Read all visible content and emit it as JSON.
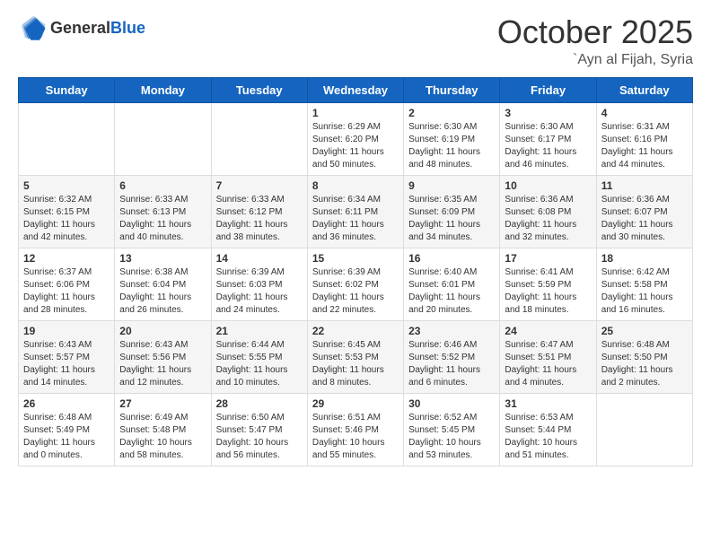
{
  "header": {
    "logo": {
      "general": "General",
      "blue": "Blue"
    },
    "title": "October 2025",
    "location": "`Ayn al Fijah, Syria"
  },
  "weekdays": [
    "Sunday",
    "Monday",
    "Tuesday",
    "Wednesday",
    "Thursday",
    "Friday",
    "Saturday"
  ],
  "weeks": [
    [
      {
        "day": null
      },
      {
        "day": null
      },
      {
        "day": null
      },
      {
        "day": 1,
        "sunrise": "Sunrise: 6:29 AM",
        "sunset": "Sunset: 6:20 PM",
        "daylight": "Daylight: 11 hours and 50 minutes."
      },
      {
        "day": 2,
        "sunrise": "Sunrise: 6:30 AM",
        "sunset": "Sunset: 6:19 PM",
        "daylight": "Daylight: 11 hours and 48 minutes."
      },
      {
        "day": 3,
        "sunrise": "Sunrise: 6:30 AM",
        "sunset": "Sunset: 6:17 PM",
        "daylight": "Daylight: 11 hours and 46 minutes."
      },
      {
        "day": 4,
        "sunrise": "Sunrise: 6:31 AM",
        "sunset": "Sunset: 6:16 PM",
        "daylight": "Daylight: 11 hours and 44 minutes."
      }
    ],
    [
      {
        "day": 5,
        "sunrise": "Sunrise: 6:32 AM",
        "sunset": "Sunset: 6:15 PM",
        "daylight": "Daylight: 11 hours and 42 minutes."
      },
      {
        "day": 6,
        "sunrise": "Sunrise: 6:33 AM",
        "sunset": "Sunset: 6:13 PM",
        "daylight": "Daylight: 11 hours and 40 minutes."
      },
      {
        "day": 7,
        "sunrise": "Sunrise: 6:33 AM",
        "sunset": "Sunset: 6:12 PM",
        "daylight": "Daylight: 11 hours and 38 minutes."
      },
      {
        "day": 8,
        "sunrise": "Sunrise: 6:34 AM",
        "sunset": "Sunset: 6:11 PM",
        "daylight": "Daylight: 11 hours and 36 minutes."
      },
      {
        "day": 9,
        "sunrise": "Sunrise: 6:35 AM",
        "sunset": "Sunset: 6:09 PM",
        "daylight": "Daylight: 11 hours and 34 minutes."
      },
      {
        "day": 10,
        "sunrise": "Sunrise: 6:36 AM",
        "sunset": "Sunset: 6:08 PM",
        "daylight": "Daylight: 11 hours and 32 minutes."
      },
      {
        "day": 11,
        "sunrise": "Sunrise: 6:36 AM",
        "sunset": "Sunset: 6:07 PM",
        "daylight": "Daylight: 11 hours and 30 minutes."
      }
    ],
    [
      {
        "day": 12,
        "sunrise": "Sunrise: 6:37 AM",
        "sunset": "Sunset: 6:06 PM",
        "daylight": "Daylight: 11 hours and 28 minutes."
      },
      {
        "day": 13,
        "sunrise": "Sunrise: 6:38 AM",
        "sunset": "Sunset: 6:04 PM",
        "daylight": "Daylight: 11 hours and 26 minutes."
      },
      {
        "day": 14,
        "sunrise": "Sunrise: 6:39 AM",
        "sunset": "Sunset: 6:03 PM",
        "daylight": "Daylight: 11 hours and 24 minutes."
      },
      {
        "day": 15,
        "sunrise": "Sunrise: 6:39 AM",
        "sunset": "Sunset: 6:02 PM",
        "daylight": "Daylight: 11 hours and 22 minutes."
      },
      {
        "day": 16,
        "sunrise": "Sunrise: 6:40 AM",
        "sunset": "Sunset: 6:01 PM",
        "daylight": "Daylight: 11 hours and 20 minutes."
      },
      {
        "day": 17,
        "sunrise": "Sunrise: 6:41 AM",
        "sunset": "Sunset: 5:59 PM",
        "daylight": "Daylight: 11 hours and 18 minutes."
      },
      {
        "day": 18,
        "sunrise": "Sunrise: 6:42 AM",
        "sunset": "Sunset: 5:58 PM",
        "daylight": "Daylight: 11 hours and 16 minutes."
      }
    ],
    [
      {
        "day": 19,
        "sunrise": "Sunrise: 6:43 AM",
        "sunset": "Sunset: 5:57 PM",
        "daylight": "Daylight: 11 hours and 14 minutes."
      },
      {
        "day": 20,
        "sunrise": "Sunrise: 6:43 AM",
        "sunset": "Sunset: 5:56 PM",
        "daylight": "Daylight: 11 hours and 12 minutes."
      },
      {
        "day": 21,
        "sunrise": "Sunrise: 6:44 AM",
        "sunset": "Sunset: 5:55 PM",
        "daylight": "Daylight: 11 hours and 10 minutes."
      },
      {
        "day": 22,
        "sunrise": "Sunrise: 6:45 AM",
        "sunset": "Sunset: 5:53 PM",
        "daylight": "Daylight: 11 hours and 8 minutes."
      },
      {
        "day": 23,
        "sunrise": "Sunrise: 6:46 AM",
        "sunset": "Sunset: 5:52 PM",
        "daylight": "Daylight: 11 hours and 6 minutes."
      },
      {
        "day": 24,
        "sunrise": "Sunrise: 6:47 AM",
        "sunset": "Sunset: 5:51 PM",
        "daylight": "Daylight: 11 hours and 4 minutes."
      },
      {
        "day": 25,
        "sunrise": "Sunrise: 6:48 AM",
        "sunset": "Sunset: 5:50 PM",
        "daylight": "Daylight: 11 hours and 2 minutes."
      }
    ],
    [
      {
        "day": 26,
        "sunrise": "Sunrise: 6:48 AM",
        "sunset": "Sunset: 5:49 PM",
        "daylight": "Daylight: 11 hours and 0 minutes."
      },
      {
        "day": 27,
        "sunrise": "Sunrise: 6:49 AM",
        "sunset": "Sunset: 5:48 PM",
        "daylight": "Daylight: 10 hours and 58 minutes."
      },
      {
        "day": 28,
        "sunrise": "Sunrise: 6:50 AM",
        "sunset": "Sunset: 5:47 PM",
        "daylight": "Daylight: 10 hours and 56 minutes."
      },
      {
        "day": 29,
        "sunrise": "Sunrise: 6:51 AM",
        "sunset": "Sunset: 5:46 PM",
        "daylight": "Daylight: 10 hours and 55 minutes."
      },
      {
        "day": 30,
        "sunrise": "Sunrise: 6:52 AM",
        "sunset": "Sunset: 5:45 PM",
        "daylight": "Daylight: 10 hours and 53 minutes."
      },
      {
        "day": 31,
        "sunrise": "Sunrise: 6:53 AM",
        "sunset": "Sunset: 5:44 PM",
        "daylight": "Daylight: 10 hours and 51 minutes."
      },
      {
        "day": null
      }
    ]
  ]
}
